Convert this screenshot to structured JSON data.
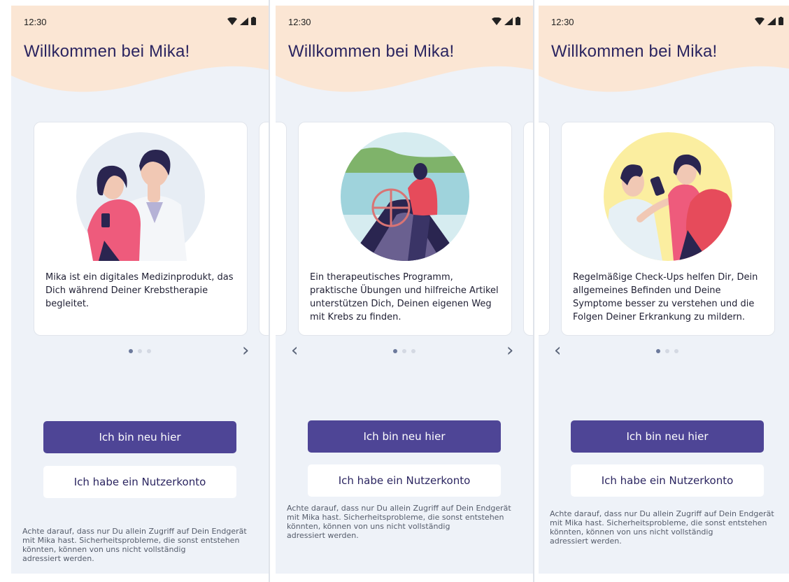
{
  "status_bar": {
    "time": "12:30"
  },
  "title": "Willkommen bei Mika!",
  "buttons": {
    "new_user": "Ich bin neu hier",
    "has_account": "Ich habe ein Nutzerkonto"
  },
  "disclaimer": {
    "line1": "Achte darauf, dass nur Du allein Zugriff auf Dein Endgerät",
    "line2": "mit Mika hast. Sicherheitsprobleme, die sonst entstehen",
    "line3": "könnten, können von uns nicht vollständig",
    "line4": "adressiert werden."
  },
  "screens": [
    {
      "illustration": "patient-and-doctor-illustration",
      "card_text": "Mika ist ein digitales Medizinprodukt, das Dich während Deiner Krebstherapie begleitet.",
      "active_dot": 0
    },
    {
      "illustration": "boat-steering-wheel-illustration",
      "card_text": "Ein therapeutisches Programm, praktische Übungen und hilfreiche Artikel unterstützen Dich, Deinen eigenen Weg mit Krebs zu finden.",
      "active_dot": 0
    },
    {
      "illustration": "checkup-heart-illustration",
      "card_text": "Regelmäßige Check-Ups helfen Dir, Dein allgemeines Befinden und Deine Symptome besser zu verstehen und die Folgen Deiner Erkrankung zu mildern.",
      "active_dot": 0
    }
  ],
  "colors": {
    "primary": "#4e4596",
    "background": "#eef2f8",
    "header_wave": "#fbe6d4",
    "title": "#2b2560"
  }
}
